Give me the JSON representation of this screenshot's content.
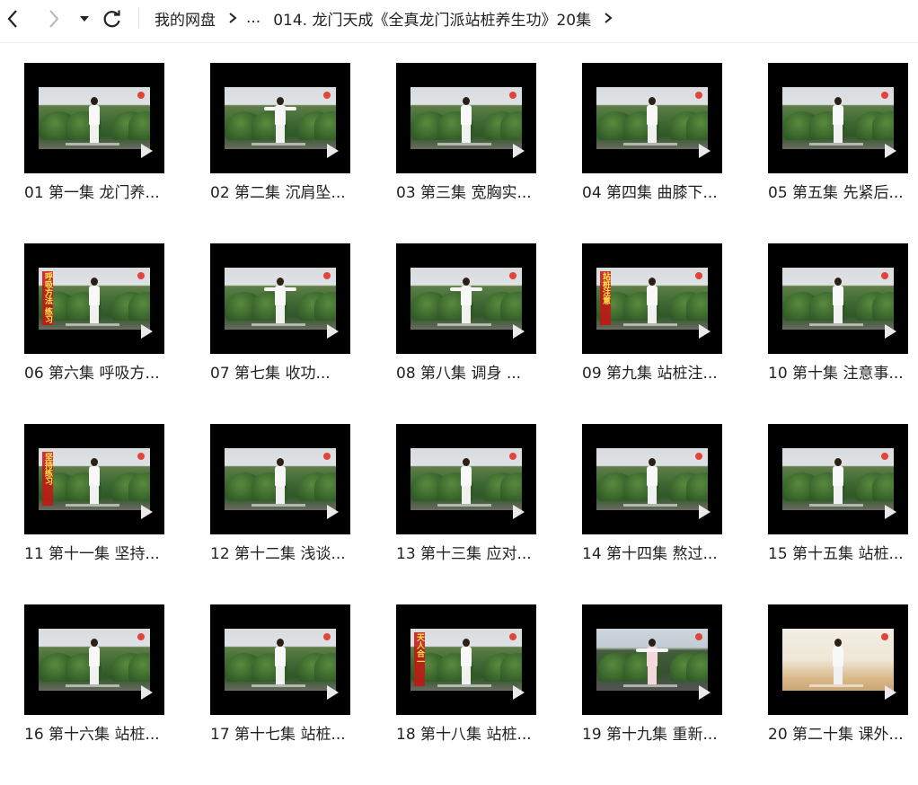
{
  "toolbar": {
    "back_icon": "chevron-left-icon",
    "forward_icon": "chevron-right-icon",
    "dropdown_icon": "caret-down-icon",
    "refresh_icon": "refresh-icon"
  },
  "breadcrumb": {
    "root": "我的网盘",
    "ellipsis": "...",
    "current": "014. 龙门天成《全真龙门派站桩养生功》20集"
  },
  "files": [
    {
      "name": "01 第一集 龙门养...",
      "scene": "garden",
      "overlay": ""
    },
    {
      "name": "02 第二集 沉肩坠...",
      "scene": "garden",
      "overlay": "",
      "arms": true
    },
    {
      "name": "03 第三集 宽胸实...",
      "scene": "garden",
      "overlay": ""
    },
    {
      "name": "04 第四集 曲膝下...",
      "scene": "garden",
      "overlay": ""
    },
    {
      "name": "05 第五集 先紧后...",
      "scene": "garden",
      "overlay": ""
    },
    {
      "name": "06 第六集 呼吸方...",
      "scene": "garden",
      "overlay": "呼吸方法 练习"
    },
    {
      "name": "07 第七集 收功...",
      "scene": "garden",
      "overlay": "",
      "arms": true
    },
    {
      "name": "08 第八集 调身 ...",
      "scene": "garden",
      "overlay": "",
      "arms": true
    },
    {
      "name": "09 第九集 站桩注...",
      "scene": "garden",
      "overlay": "站桩注意"
    },
    {
      "name": "10 第十集 注意事...",
      "scene": "garden",
      "overlay": ""
    },
    {
      "name": "11 第十一集 坚持...",
      "scene": "garden",
      "overlay": "坚持练习"
    },
    {
      "name": "12 第十二集 浅谈...",
      "scene": "garden",
      "overlay": ""
    },
    {
      "name": "13 第十三集 应对...",
      "scene": "garden",
      "overlay": ""
    },
    {
      "name": "14 第十四集 熬过...",
      "scene": "garden",
      "overlay": ""
    },
    {
      "name": "15 第十五集 站桩...",
      "scene": "garden",
      "overlay": ""
    },
    {
      "name": "16 第十六集 站桩...",
      "scene": "garden",
      "overlay": ""
    },
    {
      "name": "17 第十七集 站桩...",
      "scene": "garden",
      "overlay": ""
    },
    {
      "name": "18 第十八集 站桩...",
      "scene": "garden",
      "overlay": "天人合一"
    },
    {
      "name": "19 第十九集 重新...",
      "scene": "dusk",
      "overlay": "",
      "pink": true,
      "arms": true
    },
    {
      "name": "20 第二十集 课外...",
      "scene": "light",
      "overlay": ""
    }
  ],
  "colors": {
    "text": "#222222",
    "thumb_bg": "#000000",
    "overlay_text": "#ffe94a",
    "overlay_bg": "#c81414"
  }
}
